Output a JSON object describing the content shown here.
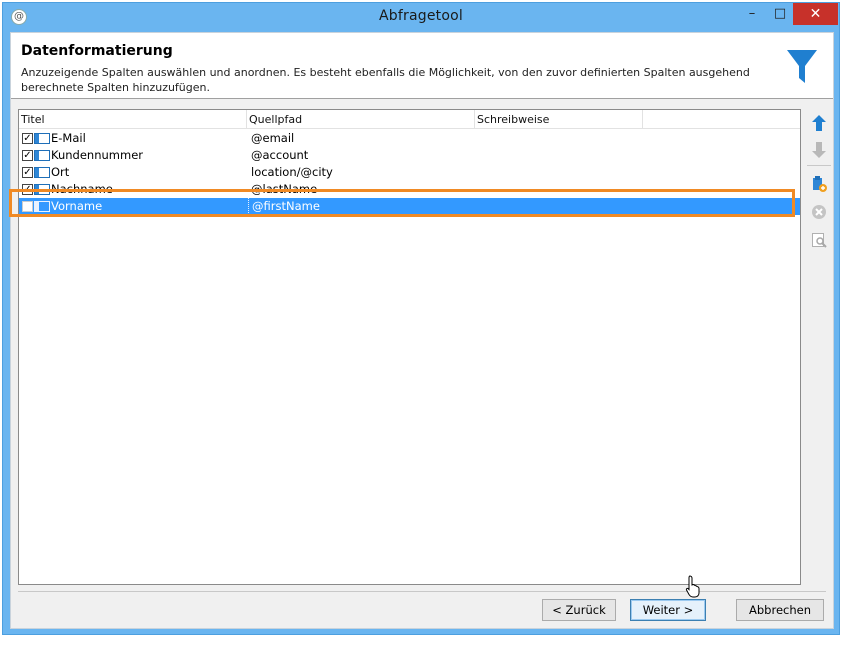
{
  "window": {
    "title": "Abfragetool",
    "minimize_glyph": "–",
    "maximize_glyph": "□",
    "close_glyph": "✕"
  },
  "header": {
    "title": "Datenformatierung",
    "description": "Anzuzeigende Spalten auswählen und anordnen. Es besteht ebenfalls die Möglichkeit, von den zuvor definierten Spalten ausgehend berechnete Spalten hinzuzufügen.",
    "icon": "funnel-icon"
  },
  "table": {
    "columns": [
      "Titel",
      "Quellpfad",
      "Schreibweise"
    ],
    "rows": [
      {
        "checked": true,
        "title": "E-Mail",
        "path": "@email",
        "format": ""
      },
      {
        "checked": true,
        "title": "Kundennummer",
        "path": "@account",
        "format": ""
      },
      {
        "checked": true,
        "title": "Ort",
        "path": "location/@city",
        "format": ""
      },
      {
        "checked": true,
        "title": "Nachname",
        "path": "@lastName",
        "format": ""
      },
      {
        "checked": false,
        "title": "Vorname",
        "path": "@firstName",
        "format": "",
        "selected": true
      }
    ]
  },
  "toolbar": {
    "icons": [
      "arrow-up-icon",
      "arrow-down-icon",
      "add-calculated-field-icon",
      "delete-icon",
      "preview-icon"
    ]
  },
  "buttons": {
    "back": "< Zurück",
    "next": "Weiter >",
    "cancel": "Abbrechen"
  },
  "colors": {
    "window_frame": "#6ab5f0",
    "close_button": "#c7312a",
    "selection": "#3399ff",
    "highlight_outline": "#f08a24",
    "accent_icon": "#1f7fd0"
  }
}
